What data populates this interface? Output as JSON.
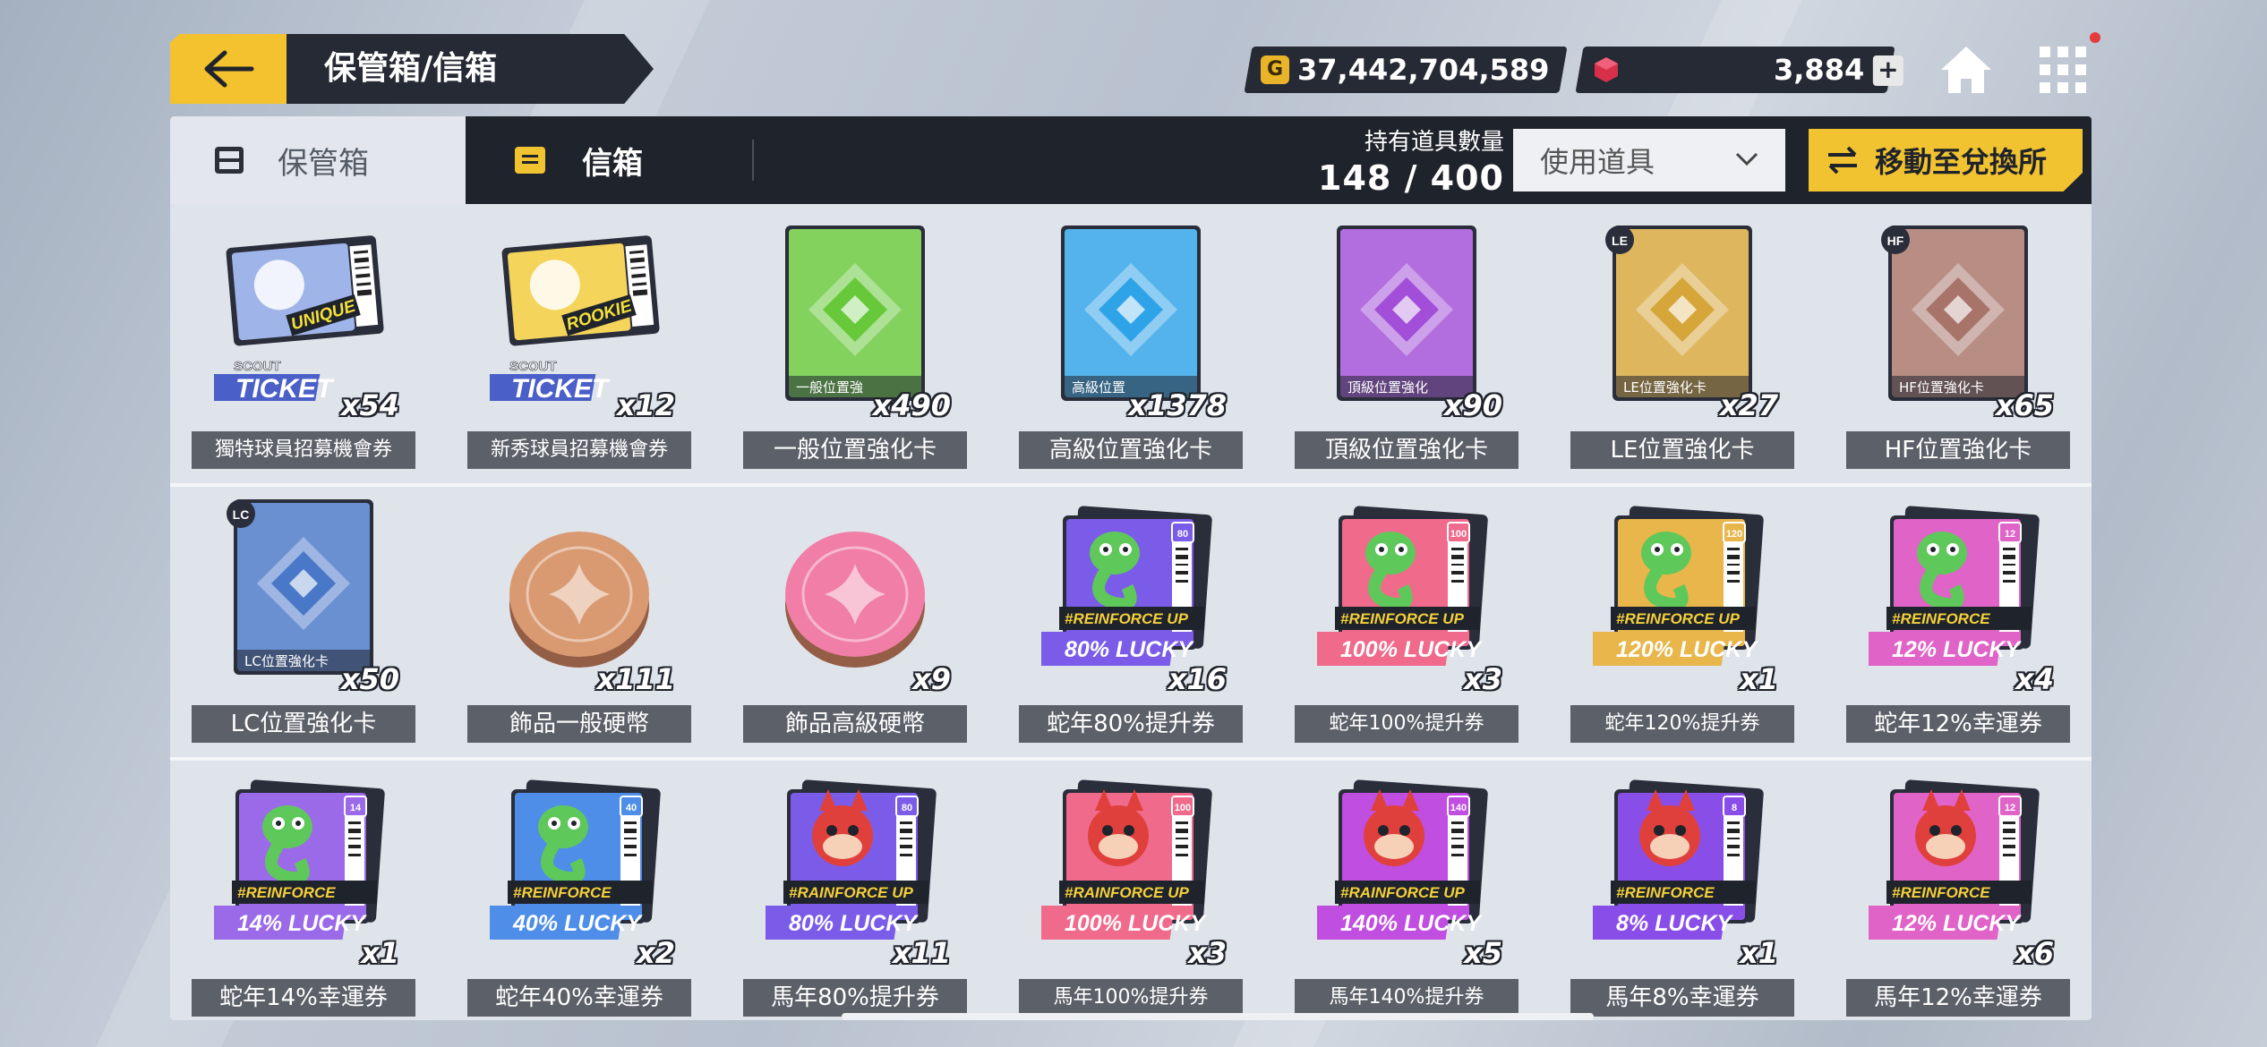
{
  "header": {
    "title": "保管箱/信箱"
  },
  "currency": {
    "gold": "37,442,704,589",
    "gold_icon_letter": "G",
    "gems": "3,884",
    "plus": "+"
  },
  "tabs": {
    "storage": "保管箱",
    "mailbox": "信箱"
  },
  "inventory": {
    "label": "持有道具數量",
    "count": "148 / 400"
  },
  "use_item": {
    "label": "使用道具"
  },
  "exchange": {
    "label": "移動至兌換所"
  },
  "colors": {
    "accent": "#f2c330",
    "dark": "#1f232b",
    "name_bg": "#5c6068"
  },
  "rows": [
    [
      {
        "name": "獨特球員招募機會券",
        "qty": "x54",
        "kind": "ticket",
        "badge": "UNIQUE",
        "scout": "SCOUT",
        "ticket": "TICKET",
        "color": "#9fb4e8"
      },
      {
        "name": "新秀球員招募機會券",
        "qty": "x12",
        "kind": "ticket",
        "badge": "ROOKIE",
        "scout": "SCOUT",
        "ticket": "TICKET",
        "color": "#f4d45a"
      },
      {
        "name": "一般位置強化卡",
        "qty": "x490",
        "kind": "card",
        "caption": "一般位置強",
        "color": "#67c93a"
      },
      {
        "name": "高級位置強化卡",
        "qty": "x1378",
        "kind": "card",
        "caption": "高級位置",
        "color": "#2fa3e8"
      },
      {
        "name": "頂級位置強化卡",
        "qty": "x90",
        "kind": "card",
        "caption": "頂級位置強化",
        "color": "#a24ed8"
      },
      {
        "name": "LE位置強化卡",
        "qty": "x27",
        "kind": "card",
        "caption": "LE位置強化卡",
        "tag": "LE",
        "color": "#d6a63b"
      },
      {
        "name": "HF位置強化卡",
        "qty": "x65",
        "kind": "card",
        "caption": "HF位置強化卡",
        "tag": "HF",
        "color": "#a8746a"
      }
    ],
    [
      {
        "name": "LC位置強化卡",
        "qty": "x50",
        "kind": "card",
        "caption": "LC位置強化卡",
        "tag": "LC",
        "color": "#4a78c8"
      },
      {
        "name": "飾品一般硬幣",
        "qty": "x111",
        "kind": "coin",
        "color": "#d99a72"
      },
      {
        "name": "飾品高級硬幣",
        "qty": "x9",
        "kind": "coin",
        "color": "#f07ea6"
      },
      {
        "name": "蛇年80%提升券",
        "qty": "x16",
        "kind": "lucky",
        "mascot": "snake",
        "band": "#REINFORCE UP",
        "lucky": "80% LUCKY",
        "num": "80",
        "color": "#7b5ce8"
      },
      {
        "name": "蛇年100%提升券",
        "qty": "x3",
        "kind": "lucky",
        "mascot": "snake",
        "band": "#REINFORCE UP",
        "lucky": "100% LUCKY",
        "num": "100",
        "color": "#f06a8c"
      },
      {
        "name": "蛇年120%提升券",
        "qty": "x1",
        "kind": "lucky",
        "mascot": "snake",
        "band": "#REINFORCE UP",
        "lucky": "120% LUCKY",
        "num": "120",
        "color": "#e8b64a"
      },
      {
        "name": "蛇年12%幸運券",
        "qty": "x4",
        "kind": "lucky",
        "mascot": "snake",
        "band": "#REINFORCE",
        "lucky": "12% LUCKY",
        "num": "12",
        "color": "#e063c8"
      }
    ],
    [
      {
        "name": "蛇年14%幸運券",
        "qty": "x1",
        "kind": "lucky",
        "mascot": "snake",
        "band": "#REINFORCE",
        "lucky": "14% LUCKY",
        "num": "14",
        "color": "#9a6ae8"
      },
      {
        "name": "蛇年40%幸運券",
        "qty": "x2",
        "kind": "lucky",
        "mascot": "snake",
        "band": "#REINFORCE",
        "lucky": "40% LUCKY",
        "num": "40",
        "color": "#4e8ee8"
      },
      {
        "name": "馬年80%提升券",
        "qty": "x11",
        "kind": "lucky",
        "mascot": "horse",
        "band": "#RAINFORCE UP",
        "lucky": "80% LUCKY",
        "num": "80",
        "color": "#7b5ce8"
      },
      {
        "name": "馬年100%提升券",
        "qty": "x3",
        "kind": "lucky",
        "mascot": "horse",
        "band": "#RAINFORCE UP",
        "lucky": "100% LUCKY",
        "num": "100",
        "color": "#f06a8c"
      },
      {
        "name": "馬年140%提升券",
        "qty": "x5",
        "kind": "lucky",
        "mascot": "horse",
        "band": "#RAINFORCE UP",
        "lucky": "140% LUCKY",
        "num": "140",
        "color": "#c04ee0"
      },
      {
        "name": "馬年8%幸運券",
        "qty": "x1",
        "kind": "lucky",
        "mascot": "horse",
        "band": "#REINFORCE",
        "lucky": "8% LUCKY",
        "num": "8",
        "color": "#8a4ee8"
      },
      {
        "name": "馬年12%幸運券",
        "qty": "x6",
        "kind": "lucky",
        "mascot": "horse",
        "band": "#REINFORCE",
        "lucky": "12% LUCKY",
        "num": "12",
        "color": "#e063c8"
      }
    ]
  ]
}
